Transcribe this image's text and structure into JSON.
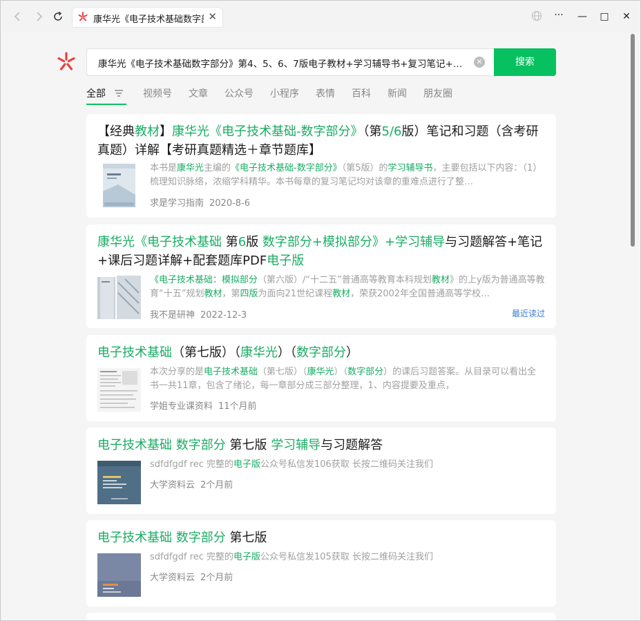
{
  "browser": {
    "tab_title": "康华光《电子技术基础数字部",
    "tab_close": "✕",
    "nav_back": "←",
    "nav_forward": "→",
    "reload": "↻",
    "more": "···",
    "minimize": "—",
    "maximize": "□",
    "close": "✕"
  },
  "search": {
    "query": "康华光《电子技术基础数字部分》第4、5、6、7版电子教材+学习辅导书+复习笔记+…",
    "button_label": "搜索",
    "clear": "✕"
  },
  "filters": [
    "全部",
    "视频号",
    "文章",
    "公众号",
    "小程序",
    "表情",
    "百科",
    "新闻",
    "朋友圈"
  ],
  "results": [
    {
      "title_parts": [
        {
          "t": "【经典",
          "h": false
        },
        {
          "t": "教材",
          "h": true
        },
        {
          "t": "】",
          "h": false
        },
        {
          "t": "康华光《电子技术基础-数字部分》",
          "h": true
        },
        {
          "t": "（第",
          "h": false
        },
        {
          "t": "5/6",
          "h": true
        },
        {
          "t": "版）笔记和习题（含考研真题）详解【考研真题精选＋章节题库】",
          "h": false
        }
      ],
      "snippet_parts": [
        {
          "t": "本书是",
          "h": false
        },
        {
          "t": "康华光",
          "h": true
        },
        {
          "t": "主编的",
          "h": false
        },
        {
          "t": "《电子技术基础-数字部分》",
          "h": true
        },
        {
          "t": "（第5版）的",
          "h": false
        },
        {
          "t": "学习辅导书",
          "h": true
        },
        {
          "t": "，主要包括以下内容：（1）梳理知识脉络，浓缩学科精华。本书每章的复习笔记均对该章的重难点进行了整…",
          "h": false
        }
      ],
      "source": "求是学习指南",
      "time": "2020-8-6",
      "recent": ""
    },
    {
      "title_parts": [
        {
          "t": "康华光《电子技术基础",
          "h": true
        },
        {
          "t": " 第",
          "h": false
        },
        {
          "t": "6",
          "h": true
        },
        {
          "t": "版 ",
          "h": false
        },
        {
          "t": "数字部分+模拟部分》+学习辅导",
          "h": true
        },
        {
          "t": "与习题解答+笔记+课后习题详解+配套题库PDF",
          "h": false
        },
        {
          "t": "电子版",
          "h": true
        }
      ],
      "snippet_parts": [
        {
          "t": "《电子技术基础：模拟部分",
          "h": true
        },
        {
          "t": "（第六版）/“十二五”普通高等教育本科规划",
          "h": false
        },
        {
          "t": "教材",
          "h": true
        },
        {
          "t": "》的上y版为普通高等教育“十五”规划",
          "h": false
        },
        {
          "t": "教材",
          "h": true
        },
        {
          "t": "，第",
          "h": false
        },
        {
          "t": "四版",
          "h": true
        },
        {
          "t": "为面向21世纪课程",
          "h": false
        },
        {
          "t": "教材",
          "h": true
        },
        {
          "t": "，荣获2002年全国普通高等学校…",
          "h": false
        }
      ],
      "source": "我不是研神",
      "time": "2022-12-3",
      "recent": "最近读过"
    },
    {
      "title_parts": [
        {
          "t": "电子技术基础",
          "h": true
        },
        {
          "t": "（第七版）（",
          "h": false
        },
        {
          "t": "康华光",
          "h": true
        },
        {
          "t": "）（",
          "h": false
        },
        {
          "t": "数字部分",
          "h": true
        },
        {
          "t": "）",
          "h": false
        }
      ],
      "snippet_parts": [
        {
          "t": "本次分享的是",
          "h": false
        },
        {
          "t": "电子技术基础",
          "h": true
        },
        {
          "t": "（第七版）（",
          "h": false
        },
        {
          "t": "康华光",
          "h": true
        },
        {
          "t": "）（",
          "h": false
        },
        {
          "t": "数字部分",
          "h": true
        },
        {
          "t": "）的课后习题答案。从目录可以看出全书一共11章，包含了绪论，每一章部分成三部分整理，1、内容提要及重点，",
          "h": false
        }
      ],
      "source": "学姐专业课资料",
      "time": "11个月前",
      "recent": ""
    },
    {
      "title_parts": [
        {
          "t": "电子技术基础 数字部分",
          "h": true
        },
        {
          "t": " 第七版 ",
          "h": false
        },
        {
          "t": "学习辅导",
          "h": true
        },
        {
          "t": "与习题解答",
          "h": false
        }
      ],
      "snippet_parts": [
        {
          "t": "sdfdfgdf rec 完整的",
          "h": false
        },
        {
          "t": "电子版",
          "h": true
        },
        {
          "t": "公众号私信发106获取 长按二维码关注我们",
          "h": false
        }
      ],
      "source": "大学资料云",
      "time": "2个月前",
      "recent": ""
    },
    {
      "title_parts": [
        {
          "t": "电子技术基础 数字部分",
          "h": true
        },
        {
          "t": " 第七版",
          "h": false
        }
      ],
      "snippet_parts": [
        {
          "t": "sdfdfgdf rec 完整的",
          "h": false
        },
        {
          "t": "电子版",
          "h": true
        },
        {
          "t": "公众号私信发105获取 长按二维码关注我们",
          "h": false
        }
      ],
      "source": "大学资料云",
      "time": "2个月前",
      "recent": ""
    }
  ],
  "colors": {
    "accent": "#07c160",
    "highlight": "#1aad63",
    "link": "#3a7bd5"
  }
}
